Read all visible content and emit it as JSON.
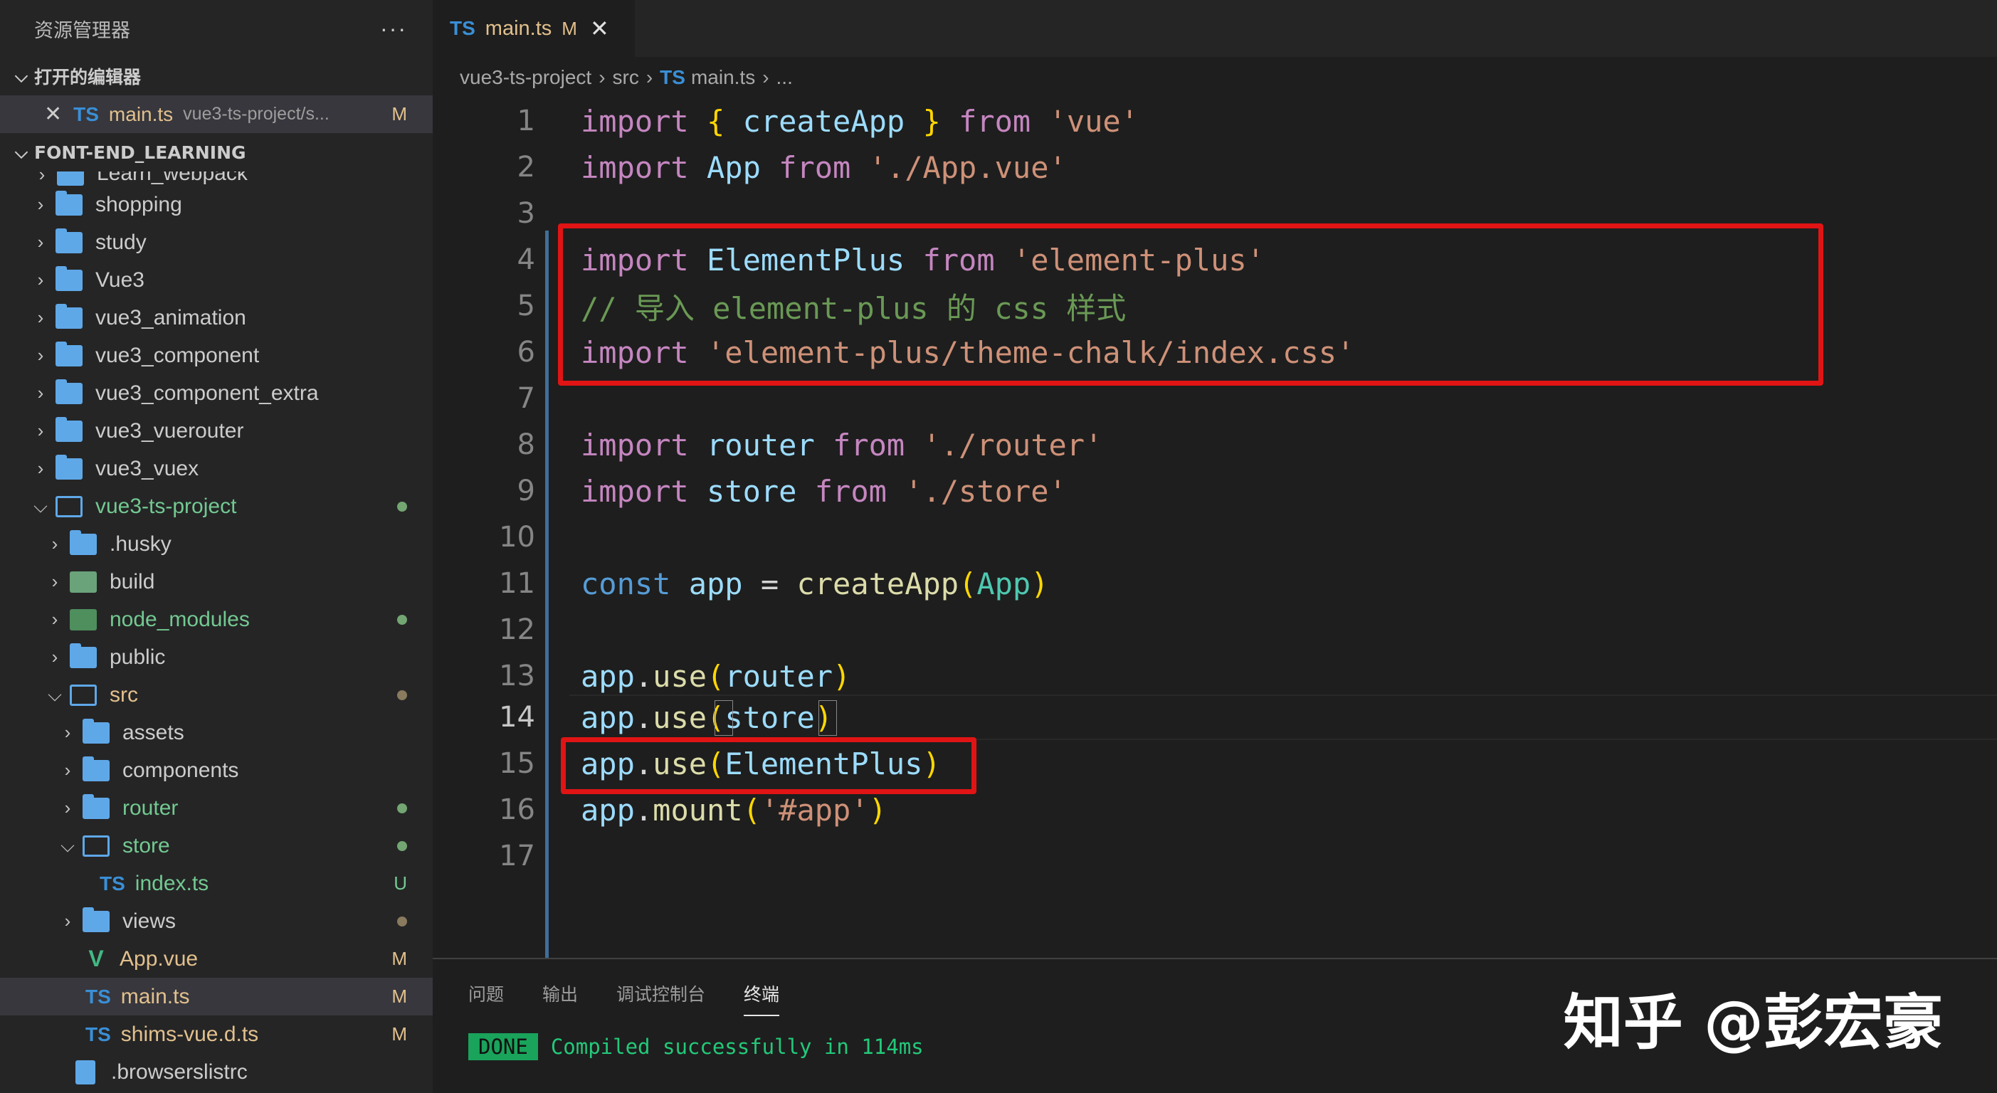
{
  "sidebar": {
    "title": "资源管理器",
    "more_label": "···",
    "open_editors_label": "打开的编辑器",
    "open_editor": {
      "close": "✕",
      "lang": "TS",
      "name": "main.ts",
      "path": "vue3-ts-project/s...",
      "status": "M"
    },
    "project_label": "FONT-END_LEARNING",
    "partial_item": "Learn_webpack",
    "items": [
      {
        "name": "shopping"
      },
      {
        "name": "study"
      },
      {
        "name": "Vue3"
      },
      {
        "name": "vue3_animation"
      },
      {
        "name": "vue3_component"
      },
      {
        "name": "vue3_component_extra"
      },
      {
        "name": "vue3_vuerouter"
      },
      {
        "name": "vue3_vuex"
      },
      {
        "name": "vue3-ts-project"
      },
      {
        "name": ".husky"
      },
      {
        "name": "build"
      },
      {
        "name": "node_modules"
      },
      {
        "name": "public"
      },
      {
        "name": "src"
      },
      {
        "name": "assets"
      },
      {
        "name": "components"
      },
      {
        "name": "router"
      },
      {
        "name": "store"
      },
      {
        "name": "index.ts",
        "lang": "TS",
        "status": "U"
      },
      {
        "name": "views"
      },
      {
        "name": "App.vue",
        "status": "M"
      },
      {
        "name": "main.ts",
        "lang": "TS",
        "status": "M"
      },
      {
        "name": "shims-vue.d.ts",
        "lang": "TS",
        "status": "M"
      },
      {
        "name": ".browserslistrc"
      }
    ]
  },
  "editor": {
    "tab": {
      "lang": "TS",
      "name": "main.ts",
      "status": "M",
      "close": "✕"
    },
    "breadcrumb": {
      "project": "vue3-ts-project",
      "folder": "src",
      "lang": "TS",
      "file": "main.ts",
      "rest": "..."
    },
    "line_numbers": [
      "1",
      "2",
      "3",
      "4",
      "5",
      "6",
      "7",
      "8",
      "9",
      "10",
      "11",
      "12",
      "13",
      "14",
      "15",
      "16",
      "17"
    ],
    "code": {
      "l1": [
        "import",
        "{",
        "createApp",
        "}",
        "from",
        "'vue'"
      ],
      "l2": [
        "import",
        "App",
        "from",
        "'./App.vue'"
      ],
      "l4": [
        "import",
        "ElementPlus",
        "from",
        "'element-plus'"
      ],
      "l5": "// 导入 element-plus 的 css 样式",
      "l6": [
        "import",
        "'element-plus/theme-chalk/index.css'"
      ],
      "l8": [
        "import",
        "router",
        "from",
        "'./router'"
      ],
      "l9": [
        "import",
        "store",
        "from",
        "'./store'"
      ],
      "l11": [
        "const",
        "app",
        "=",
        "createApp",
        "(",
        "App",
        ")"
      ],
      "l13": [
        "app",
        ".",
        "use",
        "(",
        "router",
        ")"
      ],
      "l14": [
        "app",
        ".",
        "use",
        "(",
        "store",
        ")"
      ],
      "l15": [
        "app",
        ".",
        "use",
        "(",
        "ElementPlus",
        ")"
      ],
      "l16": [
        "app",
        ".",
        "mount",
        "(",
        "'#app'",
        ")"
      ]
    }
  },
  "panel": {
    "tabs": [
      "问题",
      "输出",
      "调试控制台",
      "终端"
    ],
    "done_badge": "DONE",
    "message": "Compiled successfully in 114ms"
  },
  "watermark": "知乎 @彭宏豪",
  "colors": {
    "accent_red": "#e01414",
    "sidebar_bg": "#252526",
    "editor_bg": "#1e1e1e"
  }
}
